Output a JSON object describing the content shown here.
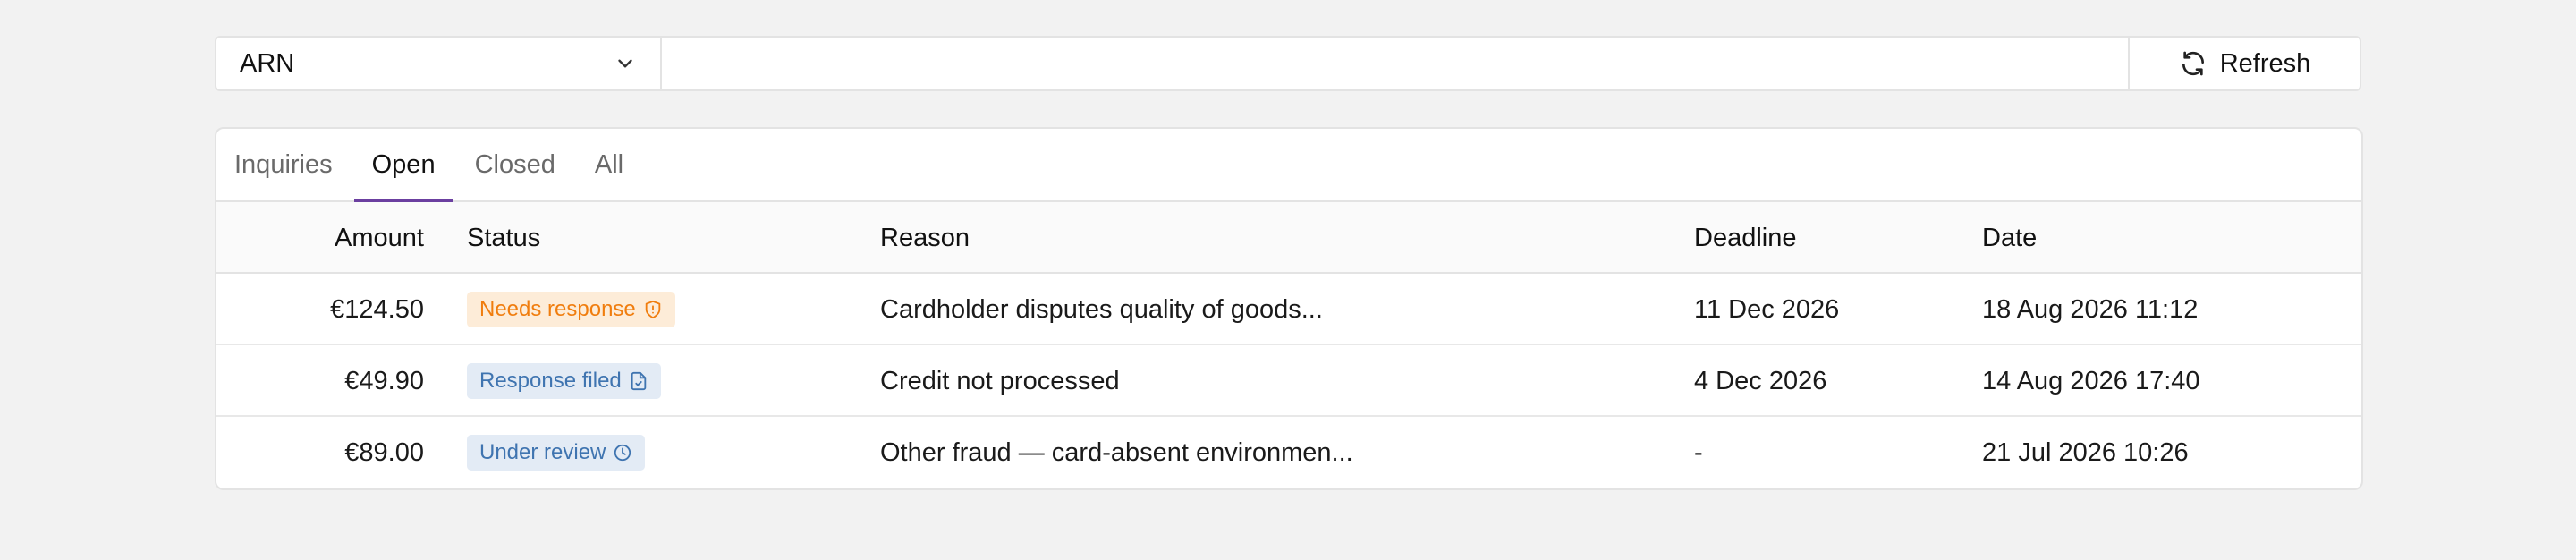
{
  "filter": {
    "select_value": "ARN",
    "search_value": "",
    "search_placeholder": "",
    "refresh_label": "Refresh"
  },
  "tabs": [
    {
      "label": "Inquiries",
      "active": false
    },
    {
      "label": "Open",
      "active": true
    },
    {
      "label": "Closed",
      "active": false
    },
    {
      "label": "All",
      "active": false
    }
  ],
  "columns": {
    "amount": "Amount",
    "status": "Status",
    "reason": "Reason",
    "deadline": "Deadline",
    "date": "Date"
  },
  "rows": [
    {
      "amount": "€124.50",
      "status": "Needs response",
      "status_icon": "shield-alert-icon",
      "status_color": "#f07d0e",
      "reason": "Cardholder disputes quality of goods...",
      "deadline": "11 Dec 2026",
      "date": "18 Aug 2026 11:12"
    },
    {
      "amount": "€49.90",
      "status": "Response filed",
      "status_icon": "file-check-icon",
      "status_color": "#3f74b0",
      "reason": "Credit not processed",
      "deadline": "4 Dec 2026",
      "date": "14 Aug 2026 17:40"
    },
    {
      "amount": "€89.00",
      "status": "Under review",
      "status_icon": "clock-icon",
      "status_color": "#3f74b0",
      "reason": "Other fraud — card-absent environmen...",
      "deadline": "-",
      "date": "21 Jul 2026 10:26"
    }
  ],
  "colors": {
    "accent": "#6b3fa0",
    "warning": "#f07d0e",
    "info": "#3f74b0"
  }
}
